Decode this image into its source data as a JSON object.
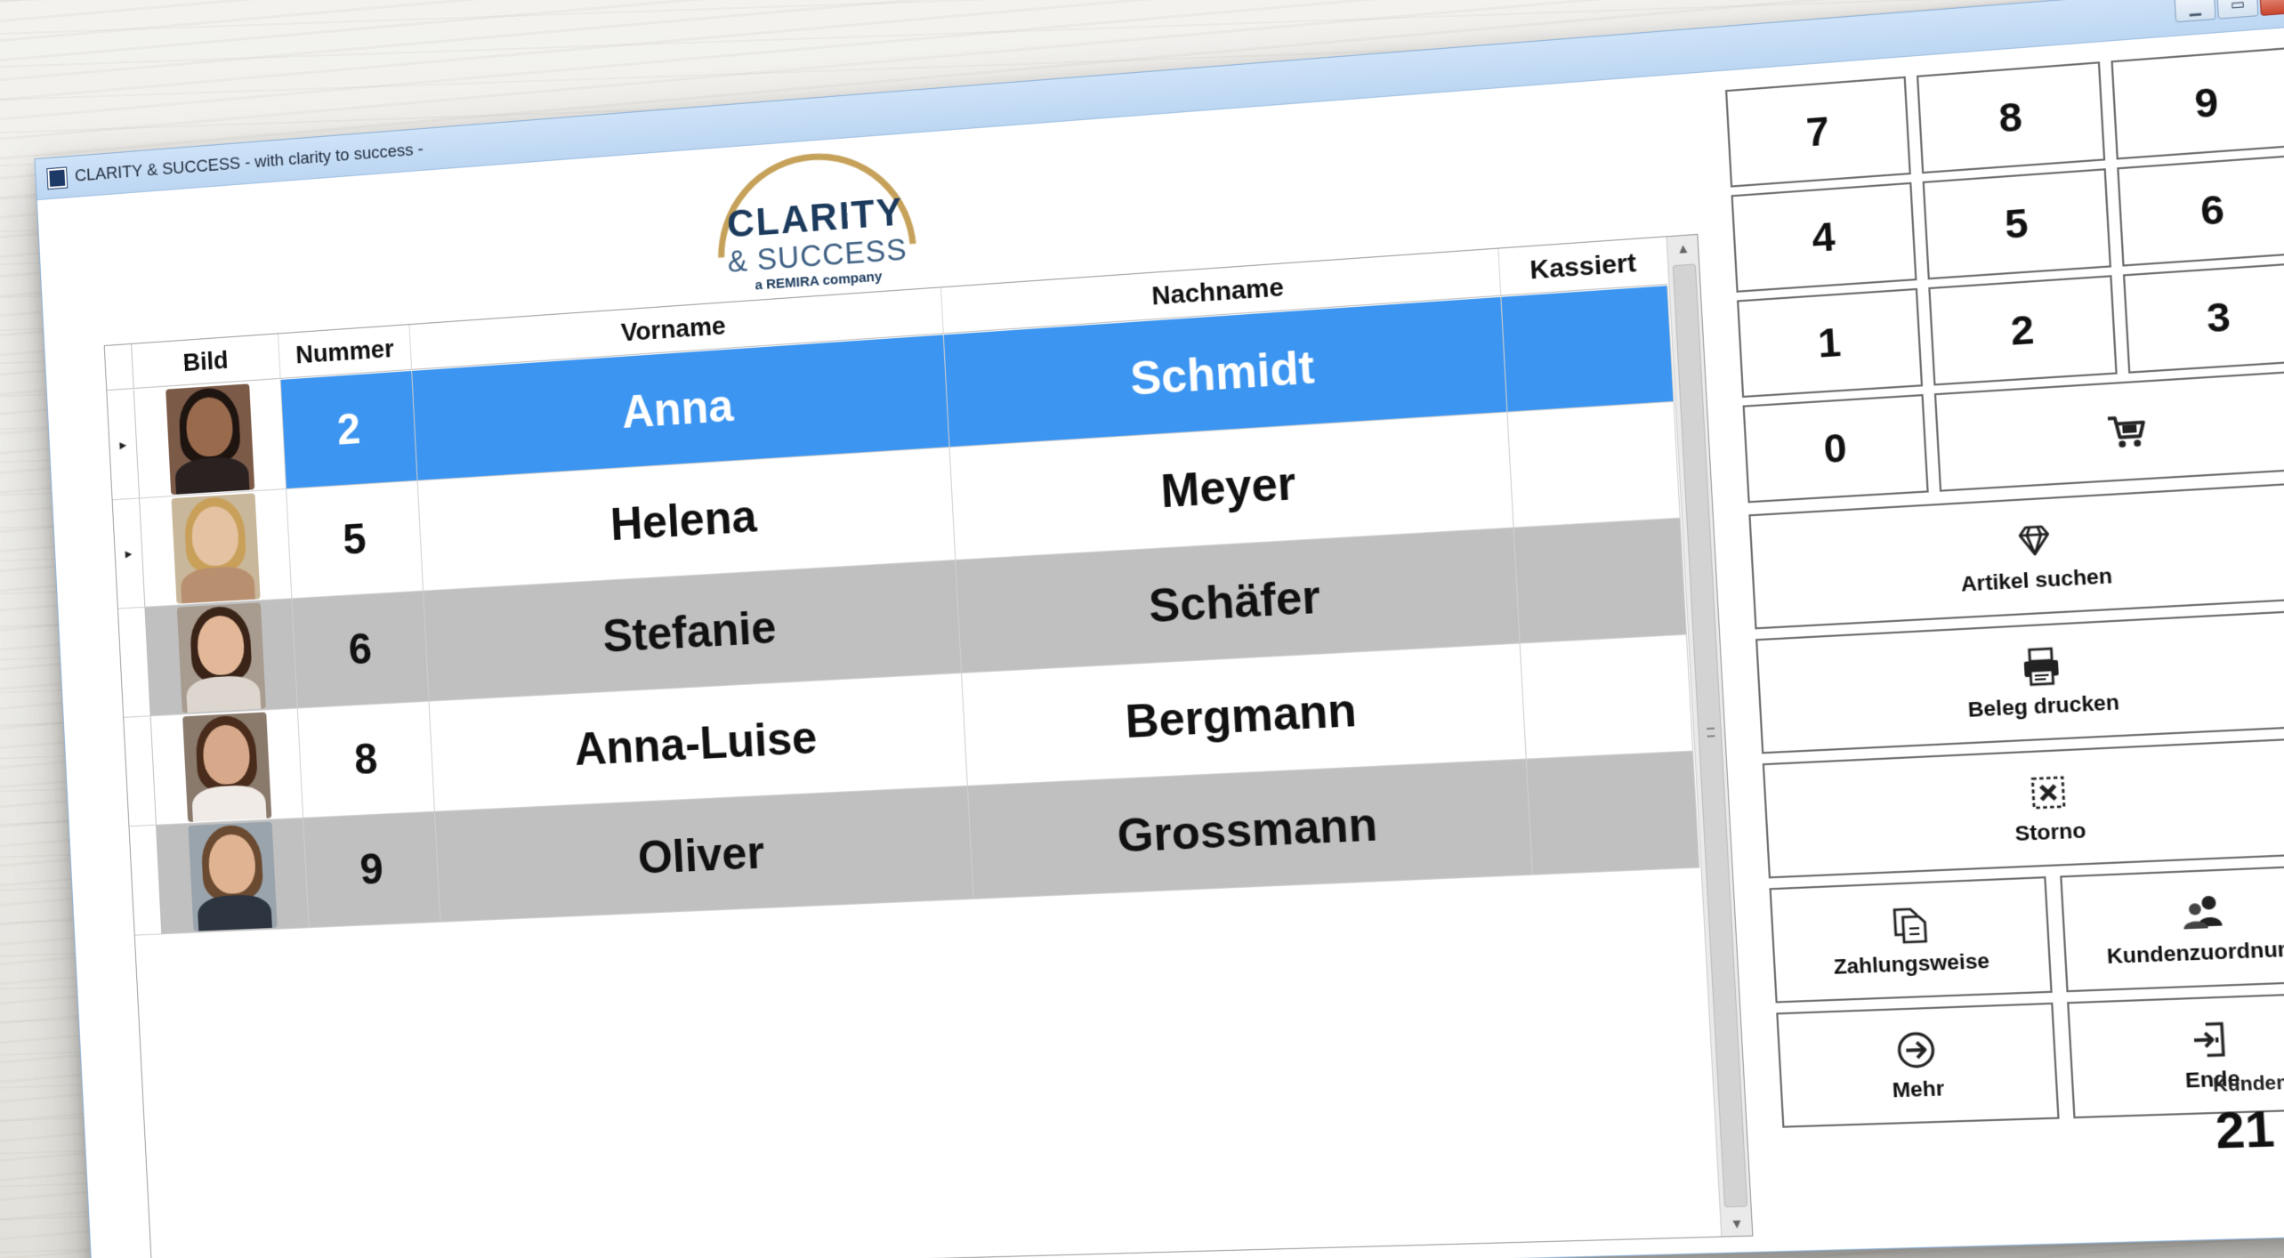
{
  "window": {
    "title": "CLARITY & SUCCESS  - with clarity to success -",
    "min_glyph": "▁",
    "max_glyph": "▭",
    "close_glyph": "x"
  },
  "logo": {
    "line1": "CLARITY",
    "line2": "& SUCCESS",
    "line3": "a REMIRA company",
    "ring_color": "#c6a15a",
    "text_color": "#1b3a5c"
  },
  "table": {
    "columns": [
      "Bild",
      "Nummer",
      "Vorname",
      "Nachname",
      "Kassiert"
    ],
    "rows": [
      {
        "nummer": "2",
        "vorname": "Anna",
        "nachname": "Schmidt",
        "kassiert": "",
        "selected": true,
        "style": "sel",
        "indicator": "▸",
        "photo": "woman-dark-hair"
      },
      {
        "nummer": "5",
        "vorname": "Helena",
        "nachname": "Meyer",
        "kassiert": "",
        "selected": false,
        "style": "white",
        "indicator": "▸",
        "photo": "woman-blonde"
      },
      {
        "nummer": "6",
        "vorname": "Stefanie",
        "nachname": "Schäfer",
        "kassiert": "",
        "selected": false,
        "style": "gray",
        "indicator": "",
        "photo": "woman-brunette"
      },
      {
        "nummer": "8",
        "vorname": "Anna-Luise",
        "nachname": "Bergmann",
        "kassiert": "",
        "selected": false,
        "style": "white",
        "indicator": "",
        "photo": "woman-brown-hair"
      },
      {
        "nummer": "9",
        "vorname": "Oliver",
        "nachname": "Grossmann",
        "kassiert": "",
        "selected": false,
        "style": "gray",
        "indicator": "",
        "photo": "man-suit"
      }
    ],
    "colors": {
      "selected": "#3c95f0",
      "alt_row": "#c0c0c0"
    }
  },
  "scrollbar": {
    "up": "▲",
    "down": "▼"
  },
  "keypad": {
    "k7": "7",
    "k8": "8",
    "k9": "9",
    "k4": "4",
    "k5": "5",
    "k6": "6",
    "k1": "1",
    "k2": "2",
    "k3": "3",
    "k0": "0"
  },
  "actions": {
    "cart_icon": "cart-icon",
    "artikel_suchen": "Artikel suchen",
    "beleg_drucken": "Beleg drucken",
    "storno": "Storno",
    "zahlungsweise": "Zahlungsweise",
    "kundenzuordnung": "Kundenzuordnung",
    "mehr": "Mehr",
    "ende": "Ende"
  },
  "kunden": {
    "label": "Kunden:",
    "value": "21"
  }
}
